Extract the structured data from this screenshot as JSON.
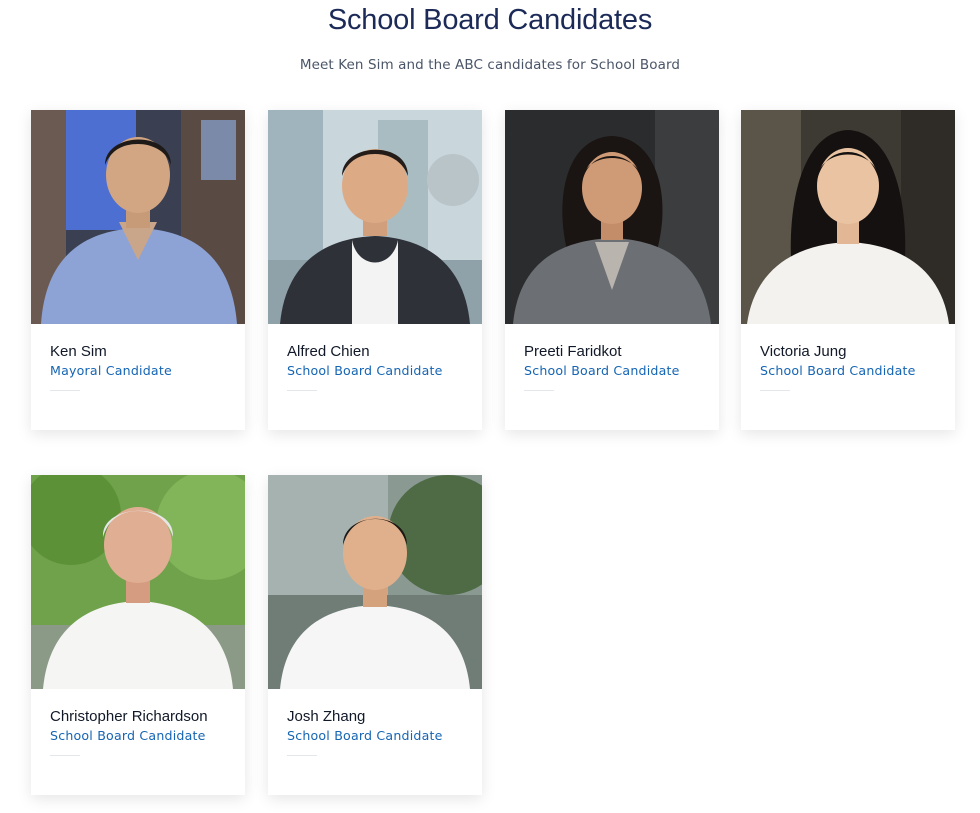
{
  "header": {
    "title": "School Board Candidates",
    "subtitle": "Meet Ken Sim and the ABC candidates for School Board"
  },
  "candidates": [
    {
      "name": "Ken Sim",
      "role": "Mayoral Candidate"
    },
    {
      "name": "Alfred Chien",
      "role": "School Board Candidate"
    },
    {
      "name": "Preeti Faridkot",
      "role": "School Board Candidate"
    },
    {
      "name": "Victoria Jung",
      "role": "School Board Candidate"
    },
    {
      "name": "Christopher Richardson",
      "role": "School Board Candidate"
    },
    {
      "name": "Josh Zhang",
      "role": "School Board Candidate"
    }
  ],
  "colors": {
    "title": "#1b2a57",
    "role_link": "#1565b4",
    "card_background": "#ffffff"
  }
}
